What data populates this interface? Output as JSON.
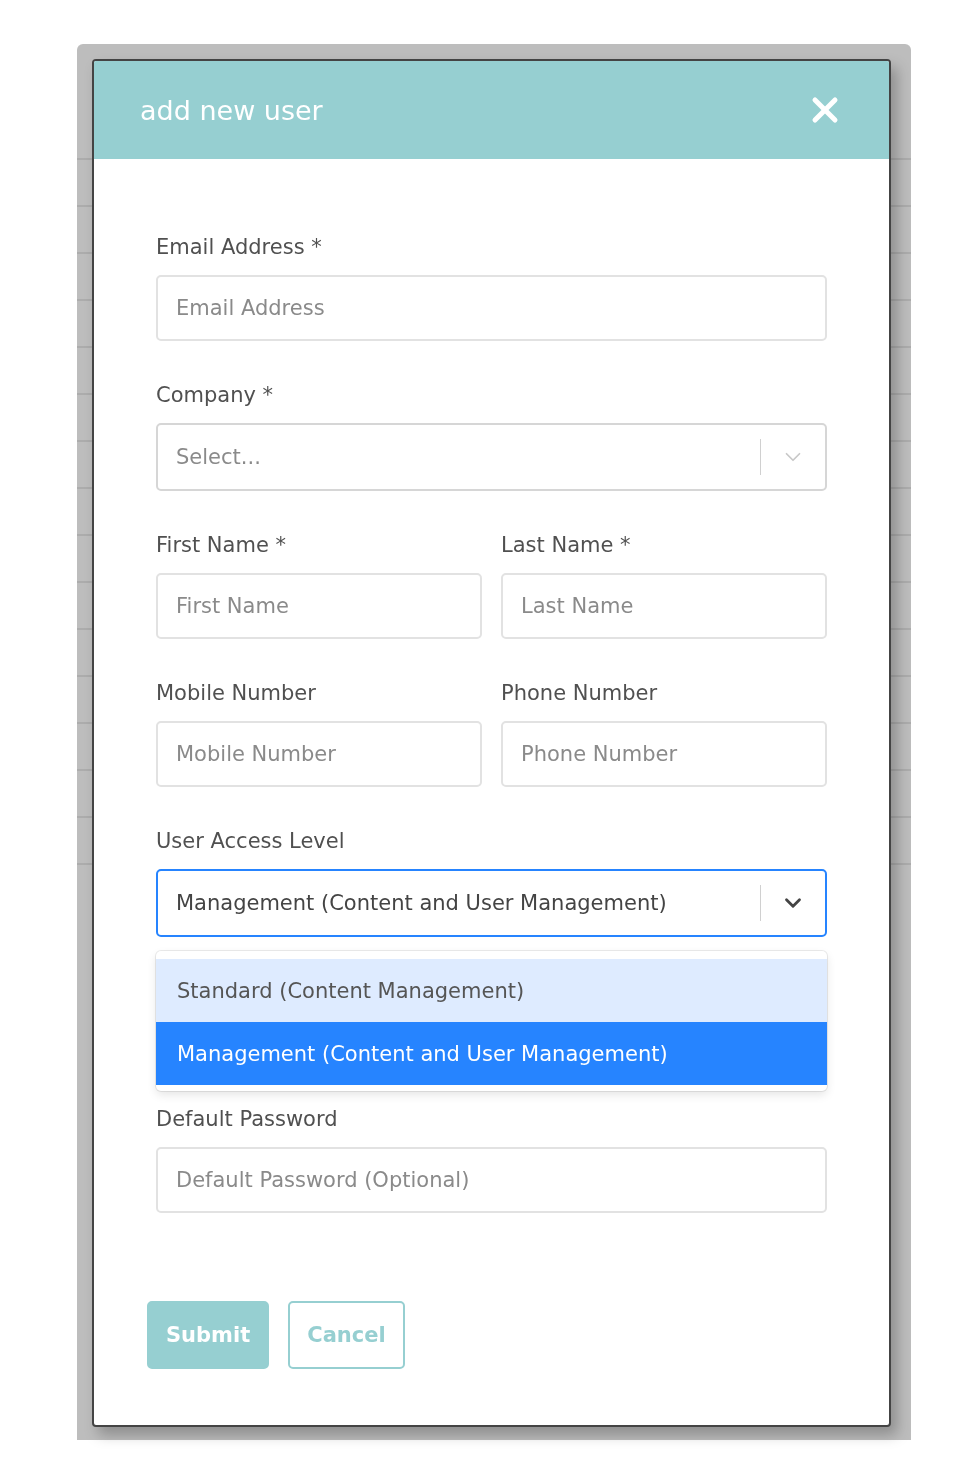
{
  "dialog": {
    "title": "add new user",
    "rows": [
      {
        "fields": [
          {
            "kind": "text",
            "label": "Email Address *",
            "placeholder": "Email Address"
          }
        ]
      },
      {
        "fields": [
          {
            "kind": "select",
            "label": "Company *",
            "placeholder": "Select...",
            "focused": false
          }
        ]
      },
      {
        "fields": [
          {
            "kind": "text",
            "label": "First Name *",
            "placeholder": "First Name"
          },
          {
            "kind": "text",
            "label": "Last Name *",
            "placeholder": "Last Name"
          }
        ]
      },
      {
        "fields": [
          {
            "kind": "text",
            "label": "Mobile Number",
            "placeholder": "Mobile Number"
          },
          {
            "kind": "text",
            "label": "Phone Number",
            "placeholder": "Phone Number"
          }
        ]
      },
      {
        "fields": [
          {
            "kind": "select",
            "label": "User Access Level",
            "value": "Management (Content and User Management)",
            "focused": true,
            "options": [
              {
                "label": "Standard (Content Management)",
                "selected": false,
                "focused": true
              },
              {
                "label": "Management (Content and User Management)",
                "selected": true,
                "focused": false
              }
            ]
          }
        ]
      },
      {
        "fields": [
          {
            "kind": "text",
            "label": "Default Password",
            "placeholder": "Default Password (Optional)"
          }
        ]
      }
    ],
    "buttons": [
      {
        "label": "Submit",
        "kind": "primary"
      },
      {
        "label": "Cancel",
        "kind": "outline"
      }
    ]
  }
}
